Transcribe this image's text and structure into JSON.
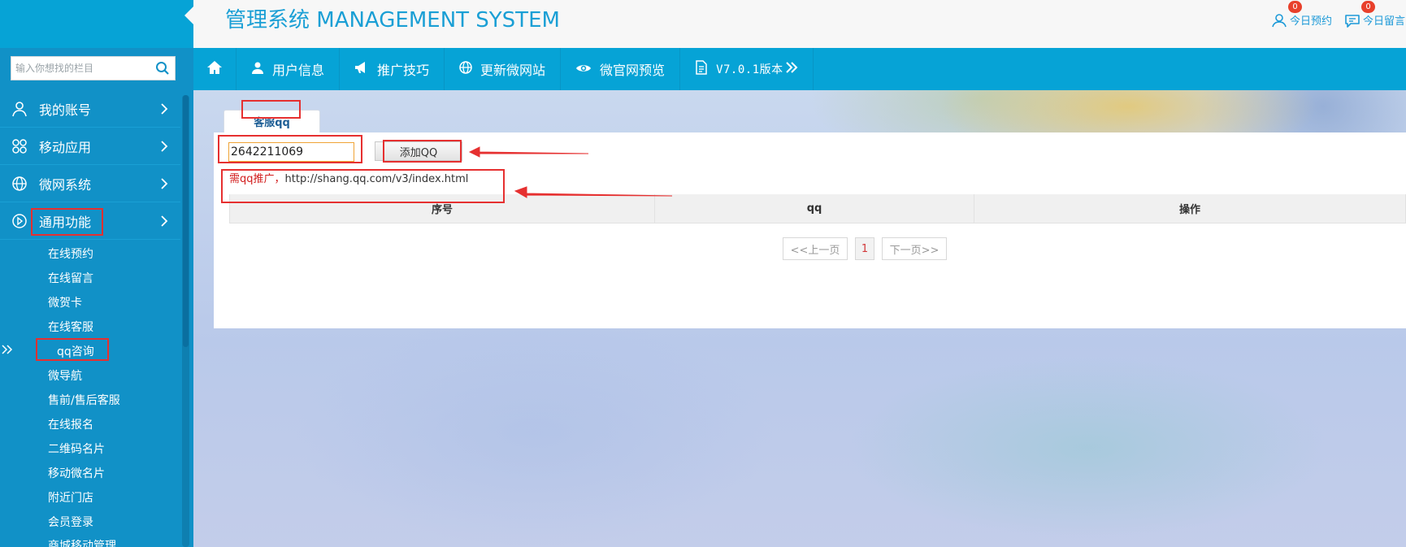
{
  "header": {
    "title": "管理系统 MANAGEMENT SYSTEM",
    "links": [
      {
        "label": "今日预约",
        "badge": "0",
        "icon": "user-icon"
      },
      {
        "label": "今日留言",
        "badge": "0",
        "icon": "chat-bubble-icon"
      }
    ]
  },
  "nav": {
    "items": [
      {
        "label": "",
        "icon": "home-icon"
      },
      {
        "label": "用户信息",
        "icon": "user-icon"
      },
      {
        "label": "推广技巧",
        "icon": "megaphone-icon"
      },
      {
        "label": "更新微网站",
        "icon": "globe-icon"
      },
      {
        "label": "微官网预览",
        "icon": "eye-icon"
      },
      {
        "label": "V7.0.1版本",
        "icon": "document-icon"
      }
    ]
  },
  "sidebar": {
    "search_placeholder": "输入你想找的栏目",
    "menus": [
      {
        "label": "我的账号",
        "icon": "user-icon"
      },
      {
        "label": "移动应用",
        "icon": "apps-icon"
      },
      {
        "label": "微网系统",
        "icon": "globe-icon"
      },
      {
        "label": "通用功能",
        "icon": "play-circle-icon"
      }
    ],
    "submenu": [
      "在线预约",
      "在线留言",
      "微贺卡",
      "在线客服",
      "qq咨询",
      "微导航",
      "售前/售后客服",
      "在线报名",
      "二维码名片",
      "移动微名片",
      "附近门店",
      "会员登录",
      "商城移动管理"
    ],
    "active_submenu": "qq咨询"
  },
  "content": {
    "tab_label": "客服qq",
    "qq_input_value": "2642211069",
    "add_button_label": "添加QQ",
    "promo_prefix": "需qq推广，",
    "promo_url": "http://shang.qq.com/v3/index.html",
    "table_headers": [
      "序号",
      "qq",
      "操作"
    ],
    "pager": {
      "prev": "<<上一页",
      "current": "1",
      "next": "下一页>>"
    }
  },
  "colors": {
    "accent": "#06a3d6",
    "sidebar": "#1191c7",
    "annotation": "#e63030"
  }
}
